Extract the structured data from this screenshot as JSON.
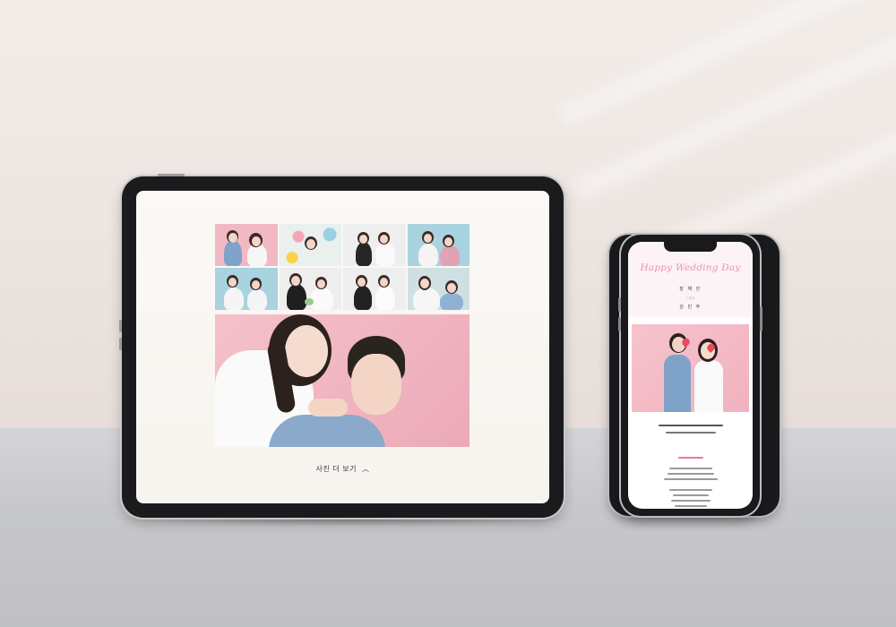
{
  "scene": {
    "colors": {
      "wall": "#ece4e0",
      "floor": "#c8c9cb",
      "device_frame": "#1b1b1d",
      "pink_backdrop": "#f2b9c4",
      "blue_backdrop": "#a8d3df",
      "accent_pink": "#ef8fb0"
    }
  },
  "tablet": {
    "gallery": {
      "thumbnails": [
        {
          "backdrop": "pink"
        },
        {
          "backdrop": "white"
        },
        {
          "backdrop": "white"
        },
        {
          "backdrop": "blue"
        },
        {
          "backdrop": "blue"
        },
        {
          "backdrop": "white"
        },
        {
          "backdrop": "white"
        },
        {
          "backdrop": "white"
        }
      ],
      "featured_photo": {
        "backdrop": "pink"
      }
    },
    "more_photos_label": "사진 더 보기",
    "more_photos_icon": "chevron-up-icon"
  },
  "phone": {
    "header_title": "Happy Wedding Day",
    "groom_name": "장 해 민",
    "and_label": "그리고",
    "bride_name": "김 민 주"
  }
}
